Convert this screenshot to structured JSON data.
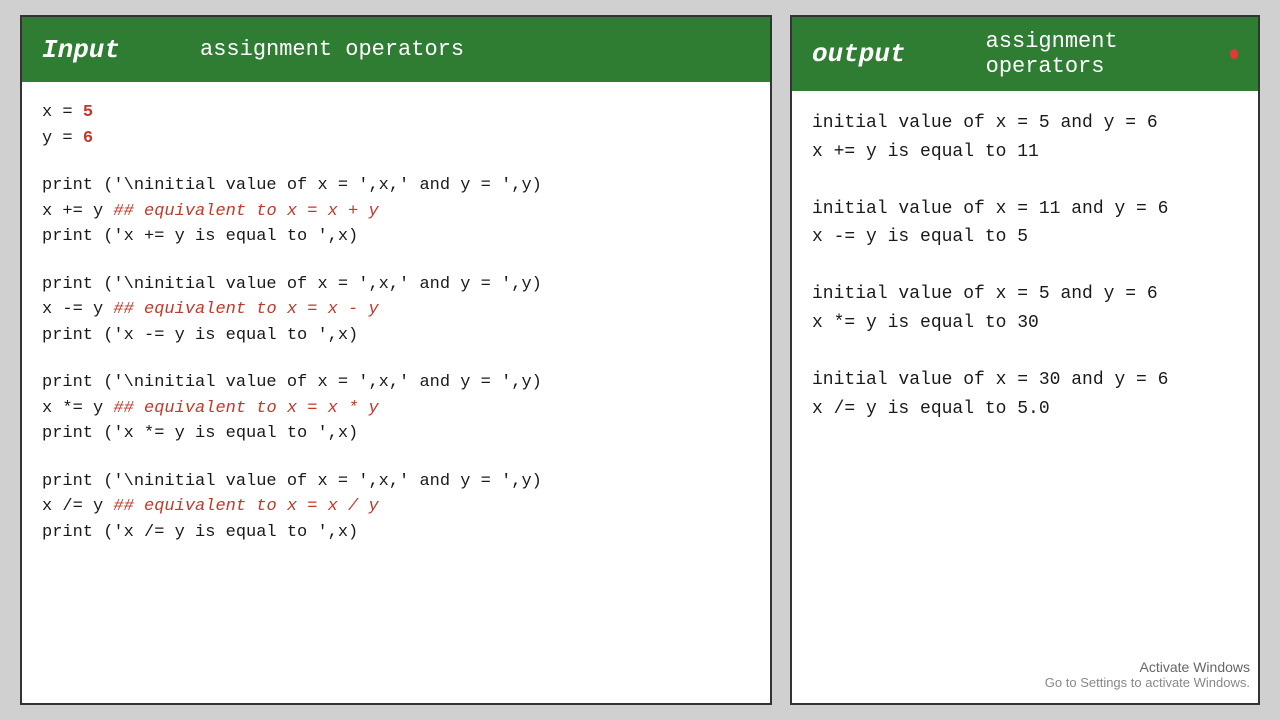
{
  "left_panel": {
    "header": {
      "word1": "Input",
      "word2": "assignment operators"
    },
    "code_blocks": [
      {
        "lines": [
          {
            "text": "x = ",
            "suffix": "5",
            "suffix_colored": true,
            "comment": ""
          },
          {
            "text": "y = ",
            "suffix": "6",
            "suffix_colored": true,
            "comment": ""
          }
        ]
      },
      {
        "lines": [
          {
            "text": "print ('\\ninitial value of x = ',x,' and y = ',y)",
            "suffix": "",
            "suffix_colored": false,
            "comment": ""
          },
          {
            "text": "x += y ",
            "suffix": "",
            "suffix_colored": false,
            "comment": "## equivalent to x = x + y"
          },
          {
            "text": "print ('x += y is equal to ',x)",
            "suffix": "",
            "suffix_colored": false,
            "comment": ""
          }
        ]
      },
      {
        "lines": [
          {
            "text": "print ('\\ninitial value of x = ',x,' and y = ',y)",
            "suffix": "",
            "suffix_colored": false,
            "comment": ""
          },
          {
            "text": "x -= y ",
            "suffix": "",
            "suffix_colored": false,
            "comment": "## equivalent to x = x - y"
          },
          {
            "text": "print ('x -= y is equal to ',x)",
            "suffix": "",
            "suffix_colored": false,
            "comment": ""
          }
        ]
      },
      {
        "lines": [
          {
            "text": "print ('\\ninitial value of x = ',x,' and y = ',y)",
            "suffix": "",
            "suffix_colored": false,
            "comment": ""
          },
          {
            "text": "x *= y ",
            "suffix": "",
            "suffix_colored": false,
            "comment": "## equivalent to x = x * y"
          },
          {
            "text": "print ('x *= y is equal to ',x)",
            "suffix": "",
            "suffix_colored": false,
            "comment": ""
          }
        ]
      },
      {
        "lines": [
          {
            "text": "print ('\\ninitial value of x = ',x,' and y = ',y)",
            "suffix": "",
            "suffix_colored": false,
            "comment": ""
          },
          {
            "text": "x /= y ",
            "suffix": "",
            "suffix_colored": false,
            "comment": "## equivalent to x = x / y"
          },
          {
            "text": "print ('x /= y is equal to ',x)",
            "suffix": "",
            "suffix_colored": false,
            "comment": ""
          }
        ]
      }
    ]
  },
  "right_panel": {
    "header": {
      "word1": "output",
      "word2": "assignment operators"
    },
    "output_blocks": [
      {
        "line1": "initial value of x =  5  and y =  6",
        "line2": "x += y is equal to  11"
      },
      {
        "line1": "initial value of x =  11  and y =  6",
        "line2": "x -= y is equal to  5"
      },
      {
        "line1": "initial value of x =  5  and y =  6",
        "line2": "x *= y is equal to  30"
      },
      {
        "line1": "initial value of x =  30  and y =  6",
        "line2": "x /= y is equal to  5.0"
      }
    ]
  },
  "activate_windows": {
    "line1": "Activate Windows",
    "line2": "Go to Settings to activate Windows."
  }
}
